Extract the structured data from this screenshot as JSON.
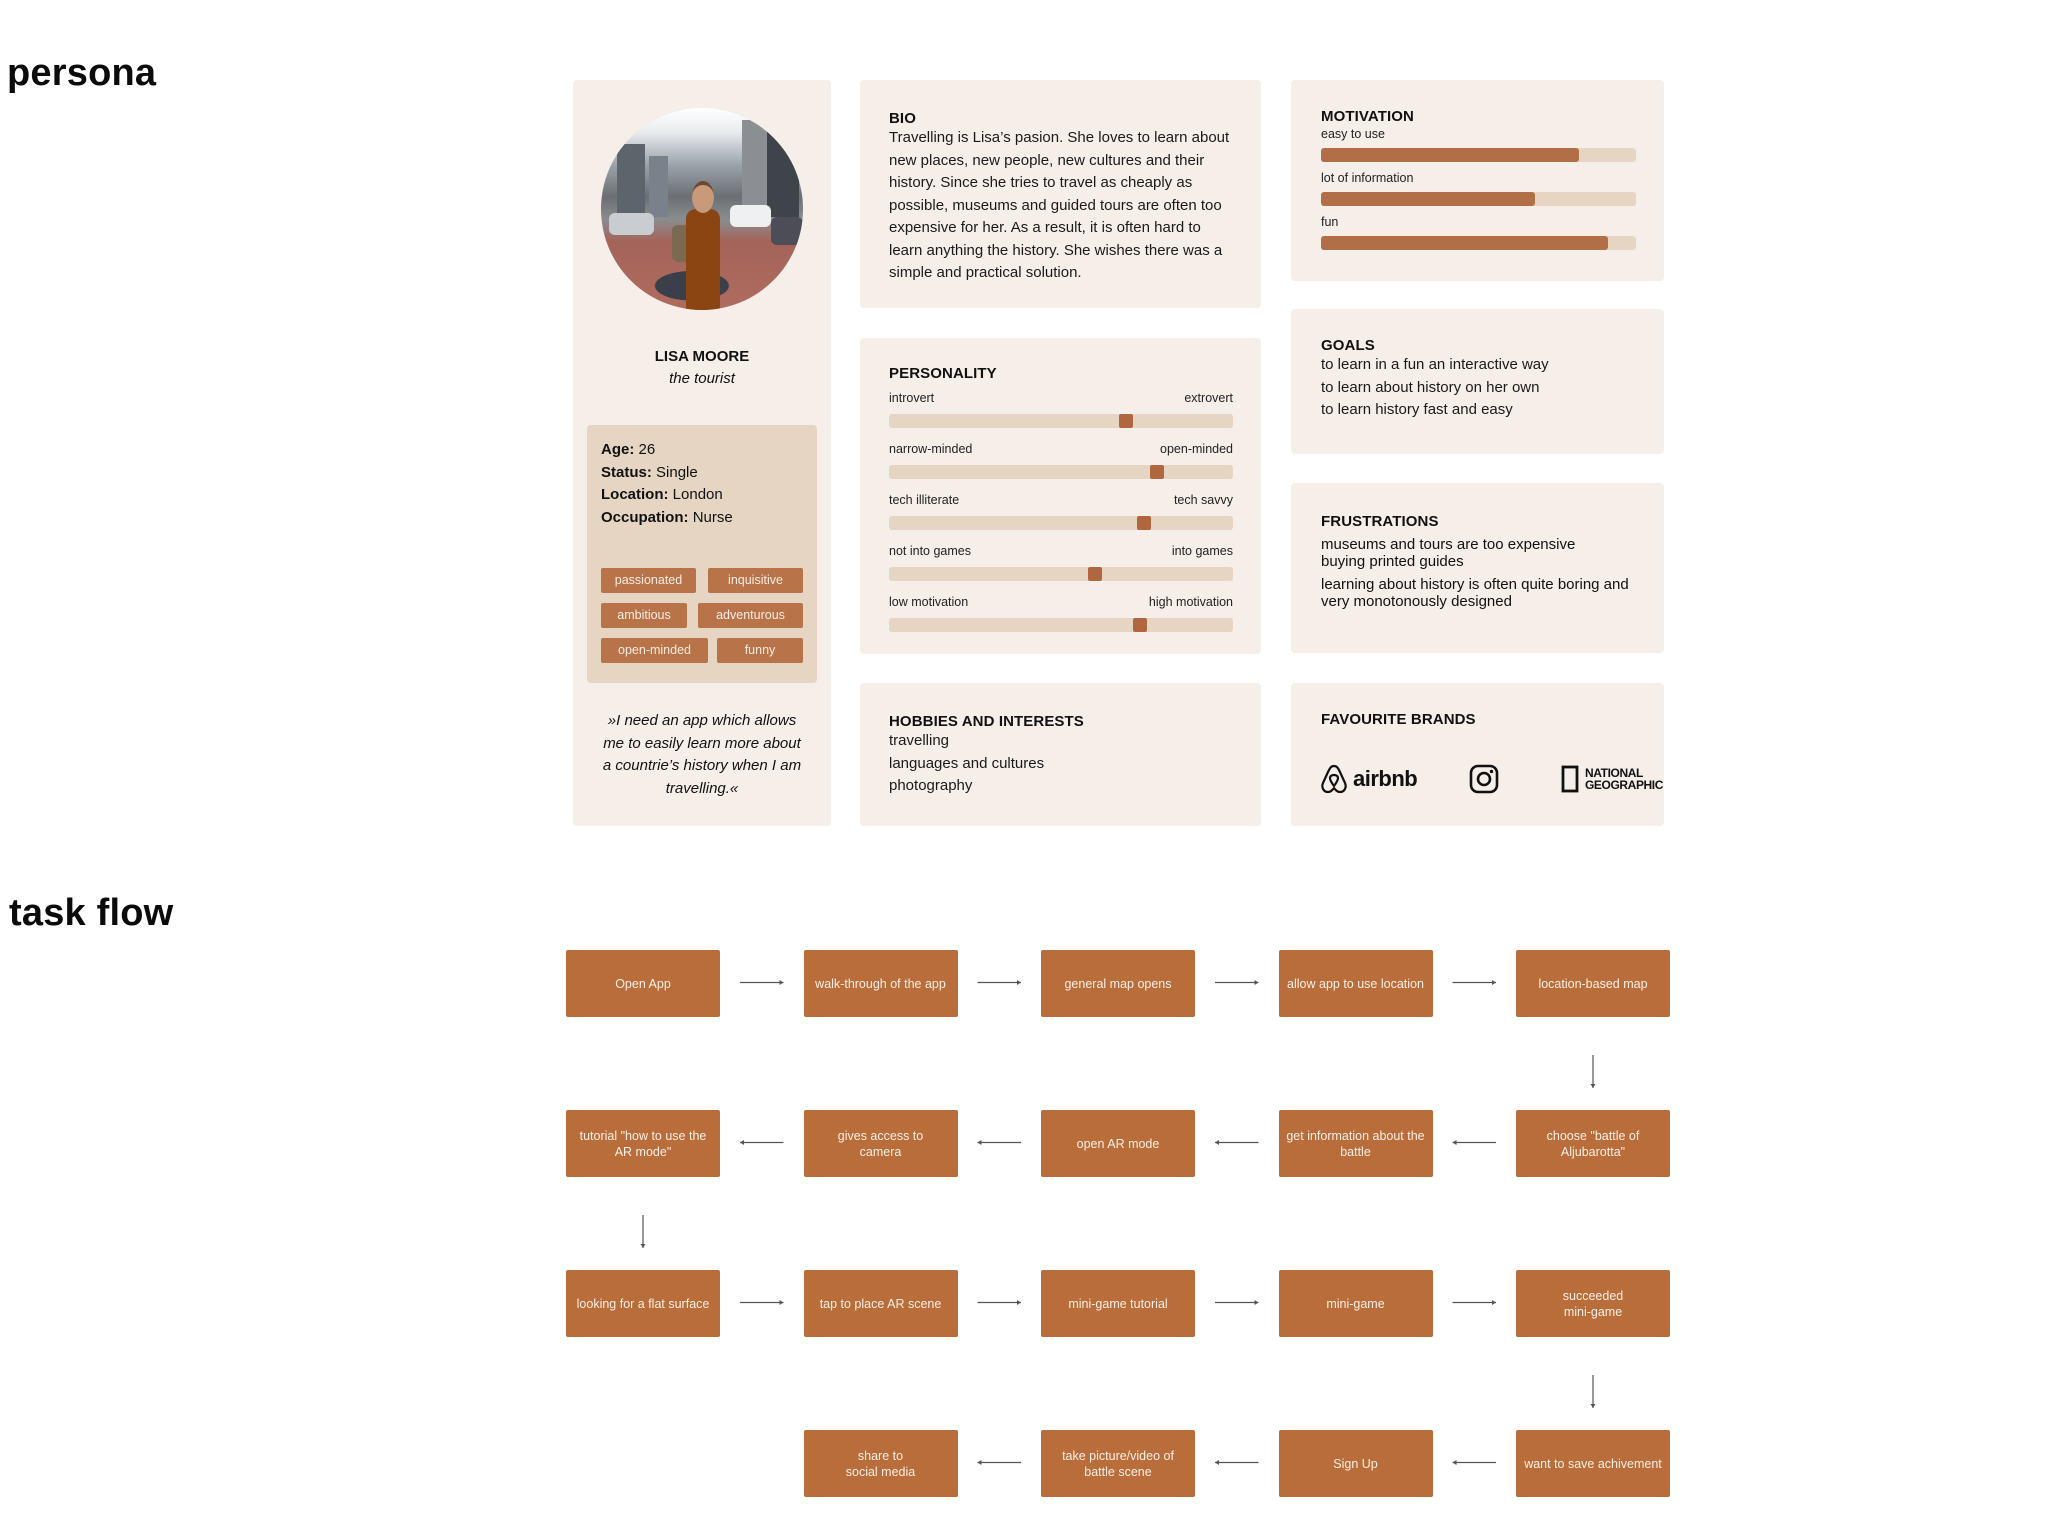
{
  "sections": {
    "persona_title": "persona",
    "taskflow_title": "task flow"
  },
  "persona": {
    "photo_icon": "portrait-photo",
    "name": "LISA MOORE",
    "role": "the tourist",
    "facts": [
      {
        "label": "Age:",
        "value": "26"
      },
      {
        "label": "Status:",
        "value": "Single"
      },
      {
        "label": "Location:",
        "value": "London"
      },
      {
        "label": "Occupation:",
        "value": "Nurse"
      }
    ],
    "traits": [
      "passionated",
      "inquisitive",
      "ambitious",
      "adventurous",
      "open-minded",
      "funny"
    ],
    "quote": "»I need an app which allows me to easily learn more about a countrie’s history when I am travelling.«"
  },
  "bio": {
    "title": "BIO",
    "text": "Travelling is Lisa’s pasion. She loves to learn about new places, new people, new cultures and their history. Since she tries to travel as cheaply as possible, museums and guided tours are often too expensive for her. As a result, it is often hard to learn anything the history. She wishes there was a simple and practical solution."
  },
  "personality": {
    "title": "PERSONALITY",
    "scales": [
      {
        "left": "introvert",
        "right": "extrovert",
        "value": 0.69
      },
      {
        "left": "narrow-minded",
        "right": "open-minded",
        "value": 0.78
      },
      {
        "left": "tech illiterate",
        "right": "tech savvy",
        "value": 0.74
      },
      {
        "left": "not into games",
        "right": "into games",
        "value": 0.6
      },
      {
        "left": "low motivation",
        "right": "high motivation",
        "value": 0.73
      }
    ]
  },
  "hobbies": {
    "title": "HOBBIES AND INTERESTS",
    "items": [
      "travelling",
      "languages and cultures",
      "photography"
    ]
  },
  "motivation": {
    "title": "MOTIVATION",
    "bars": [
      {
        "label": "easy to use",
        "value": 0.82
      },
      {
        "label": "lot of information",
        "value": 0.68
      },
      {
        "label": "fun",
        "value": 0.91
      }
    ]
  },
  "goals": {
    "title": "GOALS",
    "items": [
      "to learn in a fun an interactive way",
      "to learn about history on her own",
      "to learn history fast and easy"
    ]
  },
  "frustrations": {
    "title": "FRUSTRATIONS",
    "items": [
      "museums and tours are too expensive",
      "buying printed guides",
      "learning about history is often quite boring and very monotonously designed"
    ]
  },
  "brands": {
    "title": "FAVOURITE BRANDS",
    "items": [
      {
        "icon": "airbnb-logo-icon",
        "name": "airbnb"
      },
      {
        "icon": "instagram-logo-icon",
        "name": "Instagram"
      },
      {
        "icon": "national-geographic-logo-icon",
        "name": "NATIONAL GEOGRAPHIC",
        "line1": "NATIONAL",
        "line2": "GEOGRAPHIC"
      }
    ]
  },
  "colors": {
    "card_bg": "#f5eee9",
    "info_bg": "#e6d5c3",
    "accent": "#b96d3a",
    "box_text": "#fbeee4",
    "arrow": "#555555"
  },
  "task_flow": {
    "steps": [
      {
        "id": 1,
        "label": "Open App",
        "row": 0,
        "col": 0
      },
      {
        "id": 2,
        "label": "walk-through of the app",
        "row": 0,
        "col": 1
      },
      {
        "id": 3,
        "label": "general map opens",
        "row": 0,
        "col": 2
      },
      {
        "id": 4,
        "label": "allow app to use location",
        "row": 0,
        "col": 3
      },
      {
        "id": 5,
        "label": "location-based map",
        "row": 0,
        "col": 4
      },
      {
        "id": 6,
        "label": "choose \"battle of\nAljubarotta\"",
        "row": 1,
        "col": 4
      },
      {
        "id": 7,
        "label": "get information about the battle",
        "row": 1,
        "col": 3
      },
      {
        "id": 8,
        "label": "open AR mode",
        "row": 1,
        "col": 2
      },
      {
        "id": 9,
        "label": "gives access to\ncamera",
        "row": 1,
        "col": 1
      },
      {
        "id": 10,
        "label": "tutorial \"how to use the AR mode\"",
        "row": 1,
        "col": 0
      },
      {
        "id": 11,
        "label": "looking for a flat surface",
        "row": 2,
        "col": 0
      },
      {
        "id": 12,
        "label": "tap to place AR scene",
        "row": 2,
        "col": 1
      },
      {
        "id": 13,
        "label": "mini-game tutorial",
        "row": 2,
        "col": 2
      },
      {
        "id": 14,
        "label": "mini-game",
        "row": 2,
        "col": 3
      },
      {
        "id": 15,
        "label": "succeeded\nmini-game",
        "row": 2,
        "col": 4
      },
      {
        "id": 16,
        "label": "want to save achivement",
        "row": 3,
        "col": 4
      },
      {
        "id": 17,
        "label": "Sign Up",
        "row": 3,
        "col": 3
      },
      {
        "id": 18,
        "label": "take picture/video of\nbattle scene",
        "row": 3,
        "col": 2
      },
      {
        "id": 19,
        "label": "share to\nsocial media",
        "row": 3,
        "col": 1
      }
    ],
    "edges": [
      [
        1,
        2
      ],
      [
        2,
        3
      ],
      [
        3,
        4
      ],
      [
        4,
        5
      ],
      [
        5,
        6
      ],
      [
        6,
        7
      ],
      [
        7,
        8
      ],
      [
        8,
        9
      ],
      [
        9,
        10
      ],
      [
        10,
        11
      ],
      [
        11,
        12
      ],
      [
        12,
        13
      ],
      [
        13,
        14
      ],
      [
        14,
        15
      ],
      [
        15,
        16
      ],
      [
        16,
        17
      ],
      [
        17,
        18
      ],
      [
        18,
        19
      ]
    ]
  }
}
